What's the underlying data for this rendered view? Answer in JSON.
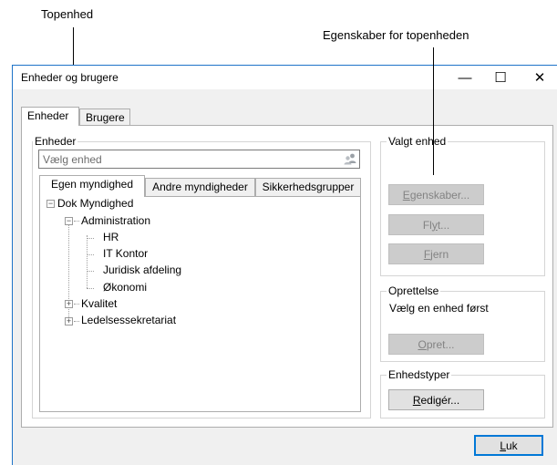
{
  "annotations": {
    "top_unit": "Topenhed",
    "properties_for_top_unit": "Egenskaber for topenheden"
  },
  "window": {
    "title": "Enheder og brugere",
    "minimize_glyph": "—",
    "maximize_glyph": "☐",
    "close_glyph": "✕"
  },
  "tabs": [
    {
      "label": "Enheder",
      "active": true
    },
    {
      "label": "Brugere",
      "active": false
    }
  ],
  "units_group": {
    "label": "Enheder",
    "search_placeholder": "Vælg enhed",
    "search_icon": "users-icon"
  },
  "inner_tabs": [
    {
      "label": "Egen myndighed",
      "active": true
    },
    {
      "label": "Andre myndigheder",
      "active": false
    },
    {
      "label": "Sikkerhedsgrupper",
      "active": false
    }
  ],
  "tree": {
    "root": {
      "label": "Dok Myndighed",
      "expander": "−"
    },
    "admin": {
      "label": "Administration",
      "expander": "−"
    },
    "admin_children": [
      "HR",
      "IT Kontor",
      "Juridisk afdeling",
      "Økonomi"
    ],
    "kvalitet": {
      "label": "Kvalitet",
      "expander": "+"
    },
    "ledelse": {
      "label": "Ledelsessekretariat",
      "expander": "+"
    }
  },
  "selected_unit": {
    "label": "Valgt enhed",
    "properties_button": {
      "pre": "",
      "u": "E",
      "post": "genskaber..."
    },
    "move_button": {
      "pre": "Fl",
      "u": "y",
      "post": "t..."
    },
    "remove_button": {
      "pre": "",
      "u": "F",
      "post": "jern"
    }
  },
  "creation": {
    "label": "Oprettelse",
    "message": "Vælg en enhed først",
    "create_button": {
      "pre": "",
      "u": "O",
      "post": "pret..."
    }
  },
  "unit_types": {
    "label": "Enhedstyper",
    "edit_button": {
      "pre": "",
      "u": "R",
      "post": "edigér..."
    }
  },
  "close_button": {
    "pre": "",
    "u": "L",
    "post": "uk"
  }
}
